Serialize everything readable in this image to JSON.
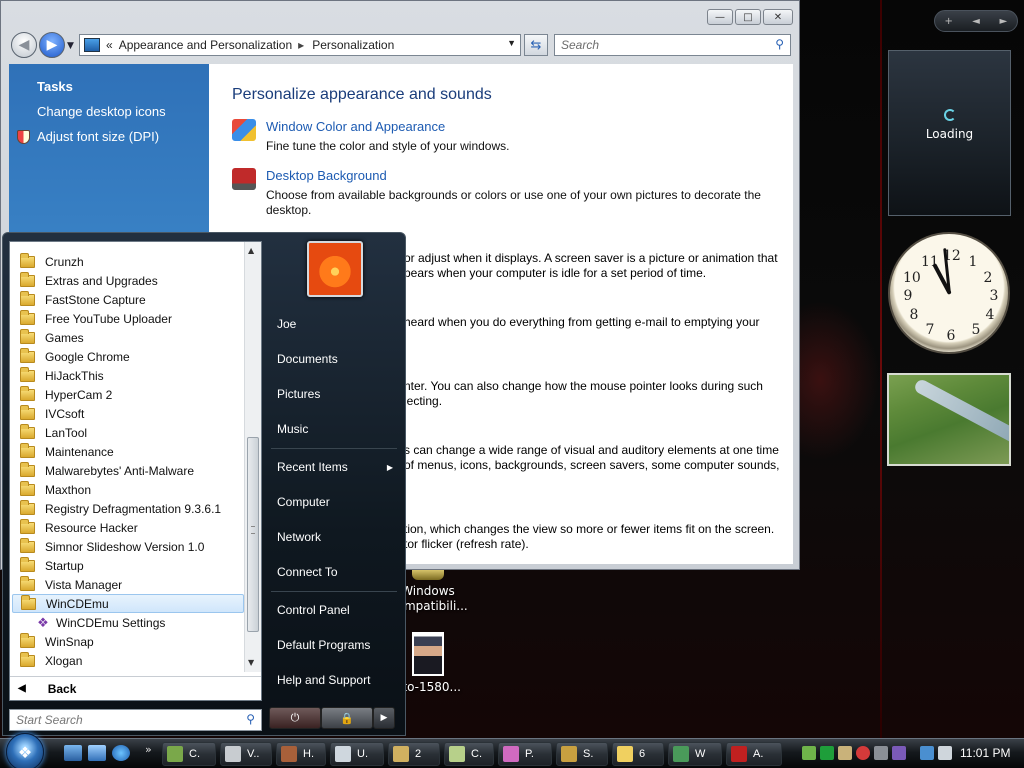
{
  "window": {
    "address": {
      "root_chevron": "«",
      "crumb1": "Appearance and Personalization",
      "crumb2": "Personalization"
    },
    "search_placeholder": "Search",
    "tasks": {
      "heading": "Tasks",
      "links": [
        "Change desktop icons",
        "Adjust font size (DPI)"
      ]
    },
    "content": {
      "title": "Personalize appearance and sounds",
      "items": [
        {
          "link": "Window Color and Appearance",
          "desc": "Fine tune the color and style of your windows."
        },
        {
          "link": "Desktop Background",
          "desc": "Choose from available backgrounds or colors or use one of your own pictures to decorate the desktop."
        }
      ],
      "partial_texts": [
        "or adjust when it displays. A screen saver is a picture or animation that",
        "pears when your computer is idle for a set period of time.",
        "heard when you do everything from getting e-mail to emptying your",
        "nter. You can also change how the mouse pointer looks during such",
        "lecting.",
        "s can change a wide range of visual and auditory elements at one time",
        "of menus, icons, backgrounds, screen savers, some computer sounds,",
        "tion, which changes the view so more or fewer items fit on the screen.",
        "tor flicker (refresh rate)."
      ]
    }
  },
  "desktop_icons": [
    {
      "label": "Windows\nCompatibili...",
      "icon": "compat-icon"
    },
    {
      "label": "oto-1580...",
      "icon": "photo-icon"
    }
  ],
  "start_menu": {
    "programs": [
      "Crunzh",
      "Extras and Upgrades",
      "FastStone Capture",
      "Free YouTube Uploader",
      "Games",
      "Google Chrome",
      "HiJackThis",
      "HyperCam 2",
      "IVCsoft",
      "LanTool",
      "Maintenance",
      "Malwarebytes' Anti-Malware",
      "Maxthon",
      "Registry Defragmentation 9.3.6.1",
      "Resource Hacker",
      "Simnor Slideshow Version 1.0",
      "Startup",
      "Vista Manager",
      "WinCDEmu"
    ],
    "selected_program": "WinCDEmu",
    "sub_item": "WinCDEmu Settings",
    "after_programs": [
      "WinSnap",
      "Xlogan"
    ],
    "back_label": "Back",
    "search_placeholder": "Start Search",
    "right_items": {
      "group1": [
        "Joe",
        "Documents",
        "Pictures",
        "Music"
      ],
      "group2": [
        "Recent Items",
        "Computer",
        "Network",
        "Connect To"
      ],
      "group3": [
        "Control Panel",
        "Default Programs",
        "Help and Support"
      ]
    }
  },
  "sidebar": {
    "loading_text": "Loading",
    "controls": [
      "+",
      "◄",
      "►"
    ]
  },
  "taskbar": {
    "tasks": [
      "C.",
      "V..",
      "H.",
      "U.",
      "2",
      "C.",
      "P.",
      "S.",
      "6",
      "W",
      "A."
    ],
    "clock": "11:01 PM"
  }
}
